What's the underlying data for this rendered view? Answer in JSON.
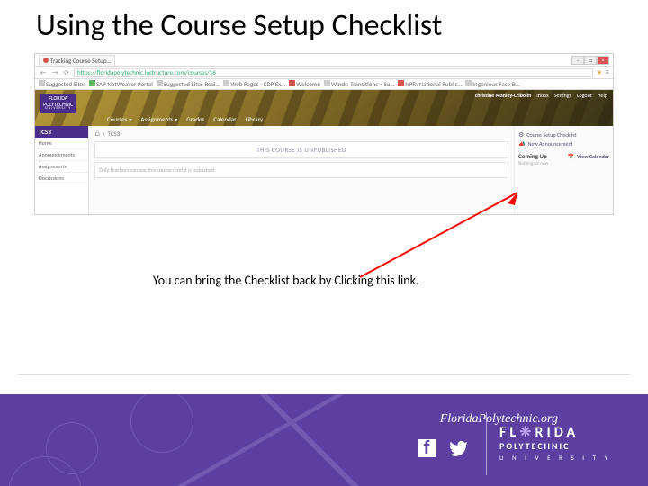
{
  "title": "Using the Course Setup Checklist",
  "annotation": "You can bring the Checklist back by Clicking this link.",
  "browser": {
    "tab_title": "Tracking Course Setup…",
    "url": "https://floridapolytechnic.instructure.com/courses/16",
    "bookmarks": [
      "Suggested Sites",
      "SAP NetWeaver Portal",
      "Suggested Sites Real…",
      "Web Pages - CDP Ex…",
      "Welcome",
      "Winds: Transitions – Su…",
      "NPR: National Public…",
      "Ingenious Face B…"
    ],
    "win": {
      "min": "–",
      "max": "□",
      "close": "×"
    }
  },
  "lms": {
    "logo": {
      "line1": "FLORIDA",
      "line2": "POLYTECHNIC",
      "line3": "UNIVERSITY"
    },
    "user": {
      "name": "christine Manley-Cribolin",
      "links": [
        "Inbox",
        "Settings",
        "Logout",
        "Help"
      ]
    },
    "nav": [
      "Courses",
      "Assignments",
      "Grades",
      "Calendar",
      "Library"
    ],
    "sidenav": {
      "header": "TCS3",
      "items": [
        "Home",
        "Announcements",
        "Assignments",
        "Discussions"
      ]
    },
    "breadcrumb": [
      "TCS3"
    ],
    "unpublished": "THIS COURSE IS UNPUBLISHED",
    "note": "Only teachers can see this course until it is published",
    "right": {
      "checklist": "Course Setup Checklist",
      "announce": "New Announcement",
      "coming": "Coming Up",
      "calendar": "View Calendar",
      "nothing": "Nothing for now"
    }
  },
  "footer": {
    "url": "FloridaPolytechnic.org",
    "logo": {
      "l1a": "FL",
      "l1b": "RIDA",
      "l2": "POLYTECHNIC",
      "l3": "U N I V E R S I T Y"
    }
  }
}
